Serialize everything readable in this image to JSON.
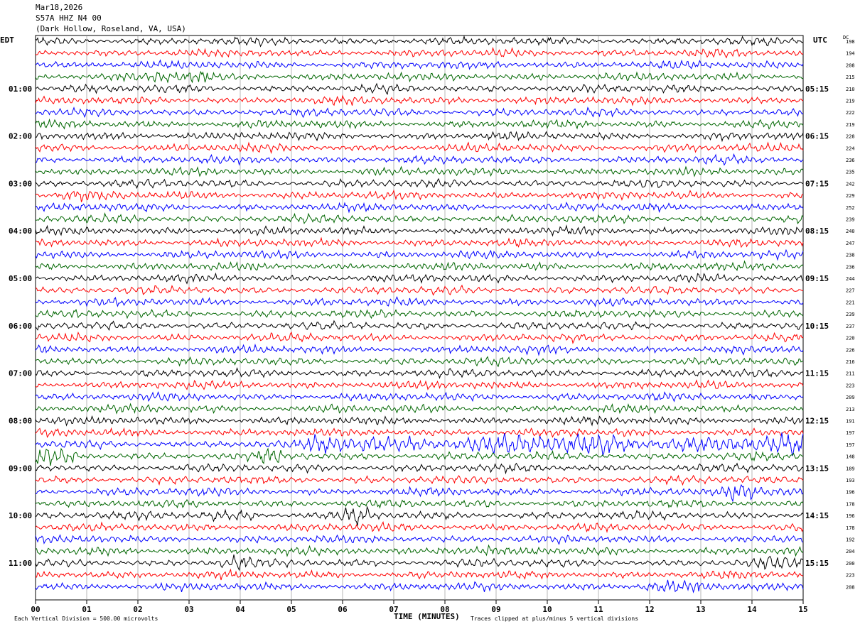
{
  "header": {
    "date": "Mar18,2026",
    "station": "S57A HHZ N4 00",
    "location": "(Dark Hollow, Roseland, VA, USA)"
  },
  "left_axis_title": "EDT",
  "right_axis_title": "UTC",
  "dc_title": "DC",
  "footer": {
    "scale_note": "Each Vertical Division =  500.00 microvolts",
    "xlabel": "TIME (MINUTES)",
    "clip_note": "Traces clipped at plus/minus 5 vertical divisions"
  },
  "chart_data": {
    "type": "line",
    "subtype": "helicorder",
    "title": "S57A HHZ N4 00 (Dark Hollow, Roseland, VA, USA) Mar18,2026",
    "xlabel": "TIME (MINUTES)",
    "x_ticks": [
      "00",
      "01",
      "02",
      "03",
      "04",
      "05",
      "06",
      "07",
      "08",
      "09",
      "10",
      "11",
      "12",
      "13",
      "14",
      "15"
    ],
    "xlim": [
      0,
      15
    ],
    "grid": true,
    "trace_colors": [
      "#000000",
      "#ff0000",
      "#0000ff",
      "#006600"
    ],
    "left_time_labels": [
      {
        "row": 4,
        "label": "01:00"
      },
      {
        "row": 8,
        "label": "02:00"
      },
      {
        "row": 12,
        "label": "03:00"
      },
      {
        "row": 16,
        "label": "04:00"
      },
      {
        "row": 20,
        "label": "05:00"
      },
      {
        "row": 24,
        "label": "06:00"
      },
      {
        "row": 28,
        "label": "07:00"
      },
      {
        "row": 32,
        "label": "08:00"
      },
      {
        "row": 36,
        "label": "09:00"
      },
      {
        "row": 40,
        "label": "10:00"
      },
      {
        "row": 44,
        "label": "11:00"
      }
    ],
    "right_time_labels": [
      {
        "row": 4,
        "label": "05:15"
      },
      {
        "row": 8,
        "label": "06:15"
      },
      {
        "row": 12,
        "label": "07:15"
      },
      {
        "row": 16,
        "label": "08:15"
      },
      {
        "row": 20,
        "label": "09:15"
      },
      {
        "row": 24,
        "label": "10:15"
      },
      {
        "row": 28,
        "label": "11:15"
      },
      {
        "row": 32,
        "label": "12:15"
      },
      {
        "row": 36,
        "label": "13:15"
      },
      {
        "row": 40,
        "label": "14:15"
      },
      {
        "row": 44,
        "label": "15:15"
      }
    ],
    "dc_offsets": [
      "198",
      "194",
      "208",
      "215",
      "210",
      "219",
      "222",
      "219",
      "228",
      "224",
      "236",
      "235",
      "242",
      "229",
      "252",
      "239",
      "240",
      "247",
      "238",
      "236",
      "244",
      "227",
      "221",
      "239",
      "237",
      "220",
      "226",
      "216",
      "211",
      "223",
      "209",
      "213",
      "191",
      "197",
      "197",
      "148",
      "189",
      "193",
      "196",
      "178",
      "196",
      "178",
      "192",
      "204",
      "200",
      "223",
      "208"
    ],
    "activity": [
      {
        "row": 3,
        "start_min": 2.3,
        "end_min": 3.4,
        "level": 1.6
      },
      {
        "row": 13,
        "start_min": 0.4,
        "end_min": 1.3,
        "level": 1.5
      },
      {
        "row": 34,
        "start_min": 5.3,
        "end_min": 15.0,
        "level": 2.6
      },
      {
        "row": 35,
        "start_min": 0.0,
        "end_min": 0.8,
        "level": 2.2
      },
      {
        "row": 35,
        "start_min": 4.3,
        "end_min": 4.8,
        "level": 2.0
      },
      {
        "row": 38,
        "start_min": 13.5,
        "end_min": 15.0,
        "level": 2.2
      },
      {
        "row": 40,
        "start_min": 6.0,
        "end_min": 6.5,
        "level": 2.4
      },
      {
        "row": 40,
        "start_min": 3.2,
        "end_min": 4.3,
        "level": 1.6
      },
      {
        "row": 43,
        "start_min": 7.8,
        "end_min": 9.0,
        "level": 1.8
      },
      {
        "row": 44,
        "start_min": 3.6,
        "end_min": 4.2,
        "level": 2.2
      },
      {
        "row": 44,
        "start_min": 14.1,
        "end_min": 15.0,
        "level": 1.8
      },
      {
        "row": 46,
        "start_min": 11.8,
        "end_min": 13.0,
        "level": 1.5
      }
    ]
  }
}
